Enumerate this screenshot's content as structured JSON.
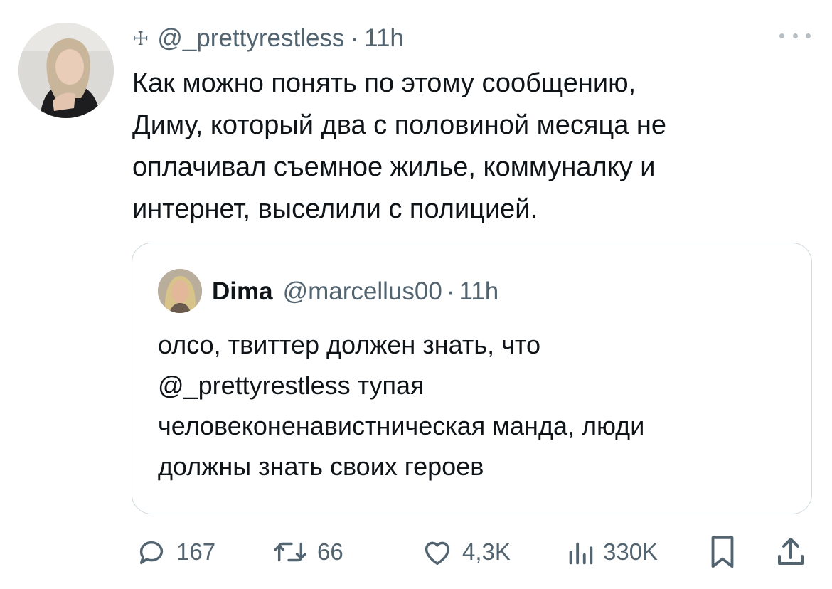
{
  "tweet": {
    "cross_glyph": "☩",
    "handle": "@_prettyrestless",
    "separator": "·",
    "time": "11h",
    "text_lines": [
      "Как можно понять по этому сообщению,",
      "Диму, который два с половиной месяца не",
      "оплачивал съемное жилье, коммуналку и",
      "интернет, выселили с полицией."
    ]
  },
  "quote": {
    "name": "Dima",
    "handle": "@marcellus00",
    "separator": "·",
    "time": "11h",
    "text_lines": [
      "олсо, твиттер должен знать, что",
      "@_prettyrestless тупая",
      "человеконенавистническая манда, люди",
      "должны знать своих героев"
    ]
  },
  "actions": {
    "replies": "167",
    "reposts": "66",
    "likes": "4,3K",
    "views": "330K"
  },
  "icons": [
    "more-icon",
    "reply-icon",
    "repost-icon",
    "like-icon",
    "views-icon",
    "bookmark-icon",
    "share-icon"
  ],
  "colors": {
    "text": "#0f1419",
    "secondary": "#536471",
    "border": "#cfd9de"
  }
}
